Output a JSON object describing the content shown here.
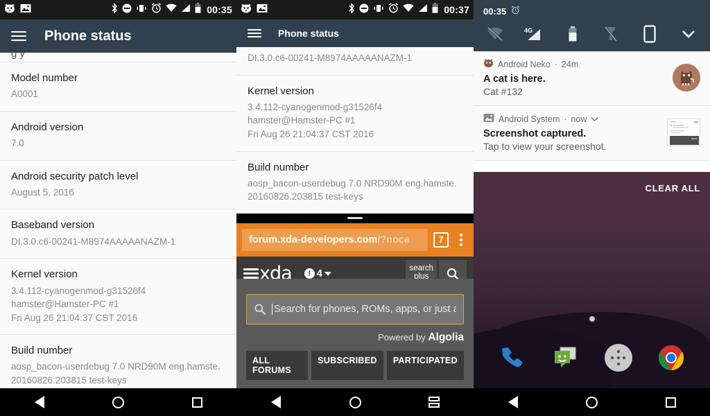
{
  "panel1": {
    "statusbar": {
      "clock": "00:35",
      "left_icons": [
        "neko-face-icon",
        "screenshot-image-icon"
      ],
      "right_icons": [
        "bluetooth-icon",
        "dnd-icon",
        "vibrate-icon",
        "alarm-icon",
        "wifi-icon",
        "signal-icon",
        "battery-icon"
      ]
    },
    "appbar": {
      "title": "Phone status",
      "menu_icon": "hamburger-menu-icon"
    },
    "clipped_row": "g y",
    "rows": [
      {
        "title": "Model number",
        "value": "A0001"
      },
      {
        "title": "Android version",
        "value": "7.0"
      },
      {
        "title": "Android security patch level",
        "value": "August 5, 2016"
      },
      {
        "title": "Baseband version",
        "value": "DI.3.0.c6-00241-M8974AAAAANAZM-1"
      },
      {
        "title": "Kernel version",
        "value": "3.4.112-cyanogenmod-g31526f4\nhamster@Hamster-PC #1\nFri Aug 26 21:04:37 CST 2016"
      },
      {
        "title": "Build number",
        "value": "aosp_bacon-userdebug 7.0 NRD90M eng.hamste.\n20160826.203815 test-keys"
      }
    ],
    "navbar": {
      "back": "back-icon",
      "home": "home-icon",
      "recents": "recents-icon"
    }
  },
  "panel2": {
    "statusbar": {
      "clock": "00:37",
      "left_icons": [
        "neko-face-icon",
        "screenshot-image-icon"
      ],
      "right_icons": [
        "bluetooth-icon",
        "dnd-icon",
        "vibrate-icon",
        "alarm-icon",
        "wifi-icon",
        "signal-icon",
        "battery-icon"
      ]
    },
    "appbar": {
      "title": "Phone status",
      "menu_icon": "hamburger-menu-icon"
    },
    "rows": [
      {
        "title": "",
        "value": "DI.3.0.c6-00241-M8974AAAAANAZM-1"
      },
      {
        "title": "Kernel version",
        "value": "3.4.112-cyanogenmod-g31526f4\nhamster@Hamster-PC #1\nFri Aug 26 21:04:37 CST 2016"
      },
      {
        "title": "Build number",
        "value": "aosp_bacon-userdebug 7.0 NRD90M eng.hamste.\n20160826.203815 test-keys"
      }
    ],
    "browser": {
      "url_main": "forum.xda-developers.com",
      "url_dim": "/?noca",
      "tab_count": "7",
      "overflow_icon": "kebab-menu-icon",
      "site": {
        "logo": "xda",
        "alerts_count": "4",
        "alerts_icon": "bell-icon",
        "search_plus_line1": "search",
        "search_plus_line2": "plus",
        "search_icon": "search-icon",
        "search_placeholder": "Search for phones, ROMs, apps, or just ask a que",
        "powered_by_prefix": "Powered by ",
        "powered_by_brand": "Algolia",
        "tabs": [
          "ALL FORUMS",
          "SUBSCRIBED",
          "PARTICIPATED"
        ]
      }
    },
    "navbar": {
      "back": "back-icon",
      "home": "home-icon",
      "recents": "recents-icon"
    }
  },
  "panel3": {
    "shade": {
      "clock": "00:35",
      "alarm_icon": "alarm-icon",
      "tiles": [
        {
          "name": "wifi-off-icon",
          "label": ""
        },
        {
          "name": "mobile-data-icon",
          "label": "4G"
        },
        {
          "name": "battery-icon",
          "label": ""
        },
        {
          "name": "flashlight-off-icon",
          "label": ""
        },
        {
          "name": "auto-rotate-icon",
          "label": ""
        },
        {
          "name": "chevron-down-icon",
          "label": ""
        }
      ]
    },
    "notifications": [
      {
        "app": "Android Neko",
        "time": "24m",
        "app_icon": "neko-face-icon",
        "title": "A cat is here.",
        "text": "Cat #132",
        "thumb": "cat-avatar"
      },
      {
        "app": "Android System",
        "time": "now",
        "app_icon": "screenshot-image-icon",
        "expand_icon": "chevron-down-icon",
        "title": "Screenshot captured.",
        "text": "Tap to view your screenshot.",
        "thumb": "screenshot-thumbnail"
      }
    ],
    "clear_all": "CLEAR ALL",
    "dock": [
      {
        "name": "phone-icon"
      },
      {
        "name": "messaging-icon"
      },
      {
        "name": "all-apps-icon"
      },
      {
        "name": "chrome-icon"
      }
    ],
    "navbar": {
      "back": "back-icon",
      "home": "home-icon",
      "recents": "recents-icon"
    }
  },
  "colors": {
    "appbar": "#30404d",
    "browser_orange": "#e8811f",
    "xda_accent": "#e8a33d",
    "statusbar": "#1b1b1b"
  }
}
